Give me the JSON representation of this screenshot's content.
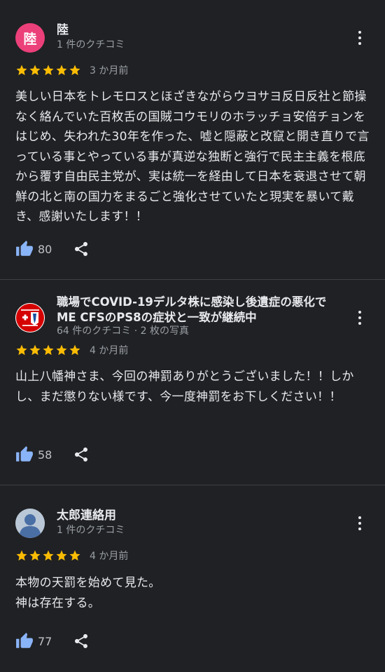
{
  "accent_color": "#8ab4f8",
  "star_color": "#fbbc04",
  "reviews": [
    {
      "avatar_letter": "陸",
      "name": "陸",
      "meta": "1 件のクチコミ",
      "rating": 5,
      "time": "3 か月前",
      "text": "美しい日本をトレモロスとほざきながらウヨサヨ反日反社と節操なく絡んでいた百枚舌の国賊コウモリのホラッチョ安倍チョンをはじめ、失われた30年を作った、嘘と隠蔽と改竄と開き直りで言っている事とやっている事が真逆な独断と強行で民主主義を根底から覆す自由民主党が、実は統一を経由して日本を衰退させて朝鮮の北と南の国力をまるごと強化させていたと現実を暴いて戴き、感謝いたします！！",
      "likes": "80"
    },
    {
      "name": "職場でCOVID-19デルタ株に感染し後遺症の悪化でME CFSのPS8の症状と一致が継続中",
      "meta": "64 件のクチコミ · 2 枚の写真",
      "rating": 5,
      "time": "4 か月前",
      "text": "山上八幡神さま、今回の神罰ありがとうございました！！しかし、まだ懲りない様です、今一度神罰をお下しください！！",
      "likes": "58"
    },
    {
      "name": "太郎連絡用",
      "meta": "1 件のクチコミ",
      "rating": 5,
      "time": "4 か月前",
      "text": "本物の天罰を始めて見た。\n神は存在する。",
      "likes": "77"
    }
  ]
}
